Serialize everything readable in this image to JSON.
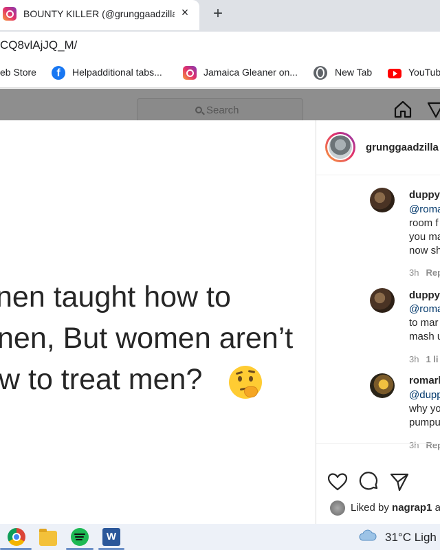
{
  "browser": {
    "tab_title": "BOUNTY KILLER (@grunggaadzilla)",
    "tab_close": "×",
    "new_tab": "+",
    "url": "CQ8vlAjJQ_M/"
  },
  "bookmarks": [
    {
      "label": "eb Store",
      "icon": "web-store-icon"
    },
    {
      "label": "Helpadditional tabs...",
      "icon": "facebook-icon"
    },
    {
      "label": "Jamaica Gleaner on...",
      "icon": "instagram-icon"
    },
    {
      "label": "New Tab",
      "icon": "globe-icon"
    },
    {
      "label": "YouTube",
      "icon": "youtube-icon"
    }
  ],
  "instagram_nav": {
    "search_placeholder": "Search",
    "icons": [
      "home-icon",
      "explore-icon"
    ]
  },
  "post": {
    "image_text_lines": [
      "nen taught how to",
      "nen, But women aren’t",
      "w to treat men?"
    ],
    "emoji": "thinking-face-emoji",
    "author": "grunggaadzilla"
  },
  "comments": [
    {
      "user": "duppy",
      "lines": [
        "@roma",
        "room f",
        "you ma",
        "now sh"
      ],
      "time": "3h",
      "action": "Rep",
      "likes": ""
    },
    {
      "user": "duppy",
      "lines": [
        "@roma",
        "to mar",
        "mash u"
      ],
      "time": "3h",
      "action": "",
      "likes": "1 li"
    },
    {
      "user": "romarl",
      "lines": [
        "@dupp",
        "why yo",
        "pumpu"
      ],
      "time": "3h",
      "action": "Rep",
      "likes": ""
    }
  ],
  "actions": {
    "icons": [
      "heart-icon",
      "comment-icon",
      "share-icon"
    ],
    "liked_prefix": "Liked by",
    "liked_user": "nagrap1",
    "liked_suffix": "a"
  },
  "taskbar": {
    "apps": [
      "chrome-icon",
      "file-explorer-icon",
      "spotify-icon",
      "word-icon"
    ],
    "weather_text": "31°C  Ligh"
  },
  "colors": {
    "overlay": "#8e8e8e",
    "link": "#00376b",
    "instagram_gradient": [
      "#f9a13b",
      "#e1306c",
      "#833ab4"
    ]
  }
}
